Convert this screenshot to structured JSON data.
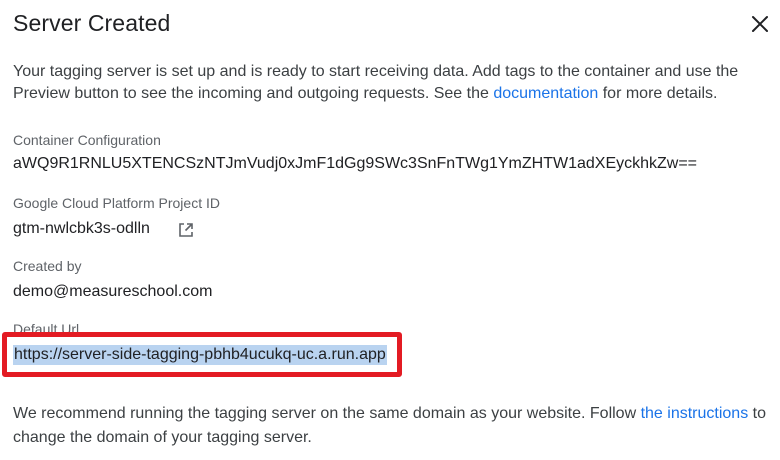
{
  "dialog": {
    "title": "Server Created",
    "intro_text": "Your tagging server is set up and is ready to start receiving data. Add tags to the container and use the Preview button to see the incoming and outgoing requests. See the ",
    "intro_link": "documentation",
    "intro_suffix": " for more details."
  },
  "fields": {
    "container_config": {
      "label": "Container Configuration",
      "value": "aWQ9R1RNLU5XTENCSzNTJmVudj0xJmF1dGg9SWc3SnFnTWg1YmZHTW1adXEyckhkZw=="
    },
    "project_id": {
      "label": "Google Cloud Platform Project ID",
      "value": "gtm-nwlcbk3s-odlln"
    },
    "created_by": {
      "label": "Created by",
      "value": "demo@measureschool.com"
    },
    "default_url": {
      "label": "Default Url",
      "value": "https://server-side-tagging-pbhb4ucukq-uc.a.run.app"
    }
  },
  "footer": {
    "text": "We recommend running the tagging server on the same domain as your website. Follow ",
    "link": "the instructions",
    "suffix": " to change the domain of your tagging server."
  },
  "icons": {
    "close": "close-icon",
    "external": "open-in-new-icon"
  },
  "colors": {
    "link": "#1a73e8",
    "highlight_border": "#e31b23",
    "selection": "#b9d3f0"
  }
}
